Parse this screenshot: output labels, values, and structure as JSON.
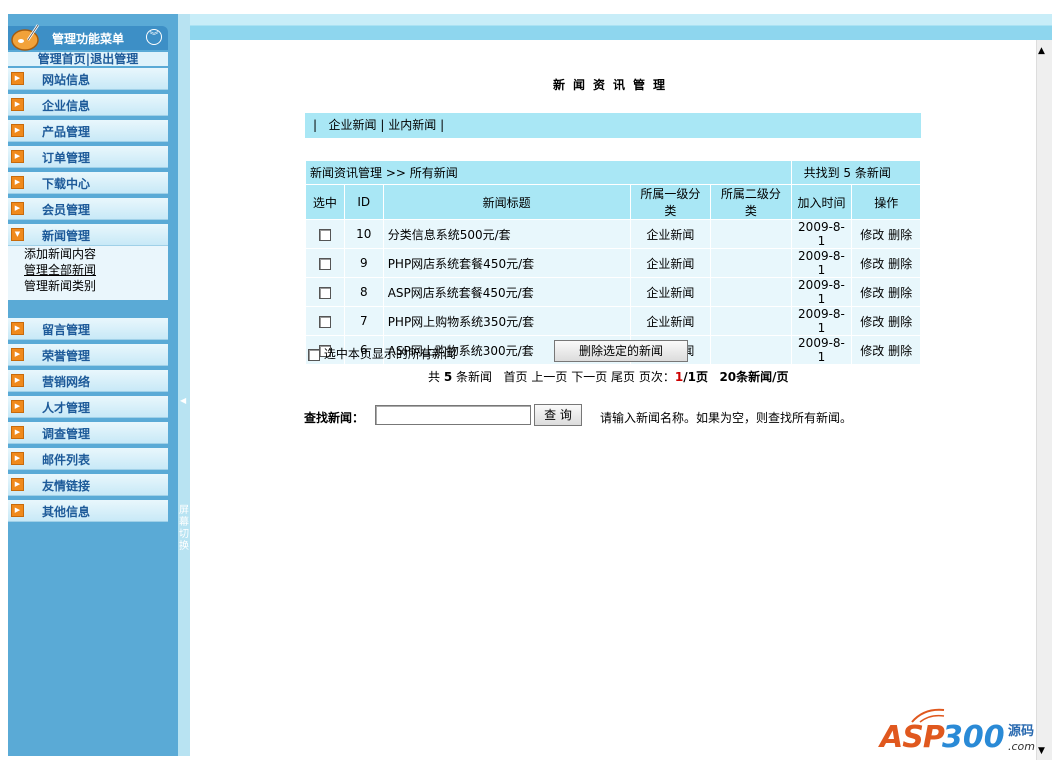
{
  "sidebar": {
    "title": "管理功能菜单",
    "home_link": "管理首页",
    "separator": "|",
    "logout_link": "退出管理",
    "items": [
      {
        "label": "网站信息"
      },
      {
        "label": "企业信息"
      },
      {
        "label": "产品管理"
      },
      {
        "label": "订单管理"
      },
      {
        "label": "下载中心"
      },
      {
        "label": "会员管理"
      },
      {
        "label": "新闻管理"
      },
      {
        "label": "留言管理"
      },
      {
        "label": "荣誉管理"
      },
      {
        "label": "营销网络"
      },
      {
        "label": "人才管理"
      },
      {
        "label": "调查管理"
      },
      {
        "label": "邮件列表"
      },
      {
        "label": "友情链接"
      },
      {
        "label": "其他信息"
      }
    ],
    "news_sub": [
      "添加新闻内容",
      "管理全部新闻",
      "管理新闻类别"
    ],
    "screen_switch": "屏幕切换"
  },
  "main": {
    "title": "新闻资讯管理",
    "categories": {
      "sep": "|",
      "items": [
        "企业新闻",
        "业内新闻"
      ]
    },
    "breadcrumb": "新闻资讯管理 >> 所有新闻",
    "count_text": "共找到 5 条新闻",
    "columns": [
      "选中",
      "ID",
      "新闻标题",
      "所属一级分类",
      "所属二级分类",
      "加入时间",
      "操作"
    ],
    "rows": [
      {
        "id": "10",
        "title": "分类信息系统500元/套",
        "cat1": "企业新闻",
        "cat2": "",
        "date": "2009-8-1"
      },
      {
        "id": "9",
        "title": "PHP网店系统套餐450元/套",
        "cat1": "企业新闻",
        "cat2": "",
        "date": "2009-8-1"
      },
      {
        "id": "8",
        "title": "ASP网店系统套餐450元/套",
        "cat1": "企业新闻",
        "cat2": "",
        "date": "2009-8-1"
      },
      {
        "id": "7",
        "title": "PHP网上购物系统350元/套",
        "cat1": "企业新闻",
        "cat2": "",
        "date": "2009-8-1"
      },
      {
        "id": "6",
        "title": "ASP网上购物系统300元/套",
        "cat1": "企业新闻",
        "cat2": "",
        "date": "2009-8-1"
      }
    ],
    "edit_label": "修改",
    "delete_label": "删除",
    "select_all_label": "选中本页显示的所有新闻",
    "delete_selected_label": "删除选定的新闻",
    "pager": {
      "total_prefix": "共",
      "total": "5",
      "total_suffix": "条新闻",
      "first": "首页",
      "prev": "上一页",
      "next": "下一页",
      "last": "尾页",
      "page_prefix": "页次：",
      "current": "1",
      "page_total": "/1页",
      "per_page": "20条新闻/页"
    },
    "search": {
      "label": "查找新闻：",
      "button": "查 询",
      "hint": "请输入新闻名称。如果为空，则查找所有新闻。",
      "value": ""
    }
  },
  "watermark": {
    "asp": "ASP",
    "num": "300",
    "yuanma": "源码",
    "com": ".com"
  },
  "colors": {
    "sidebar_bg": "#5aaad6",
    "header_bg": "#a9e7f5",
    "row_bg": "#e8f7fc",
    "menu_text": "#1d5a99",
    "accent_orange": "#f08a1c"
  }
}
